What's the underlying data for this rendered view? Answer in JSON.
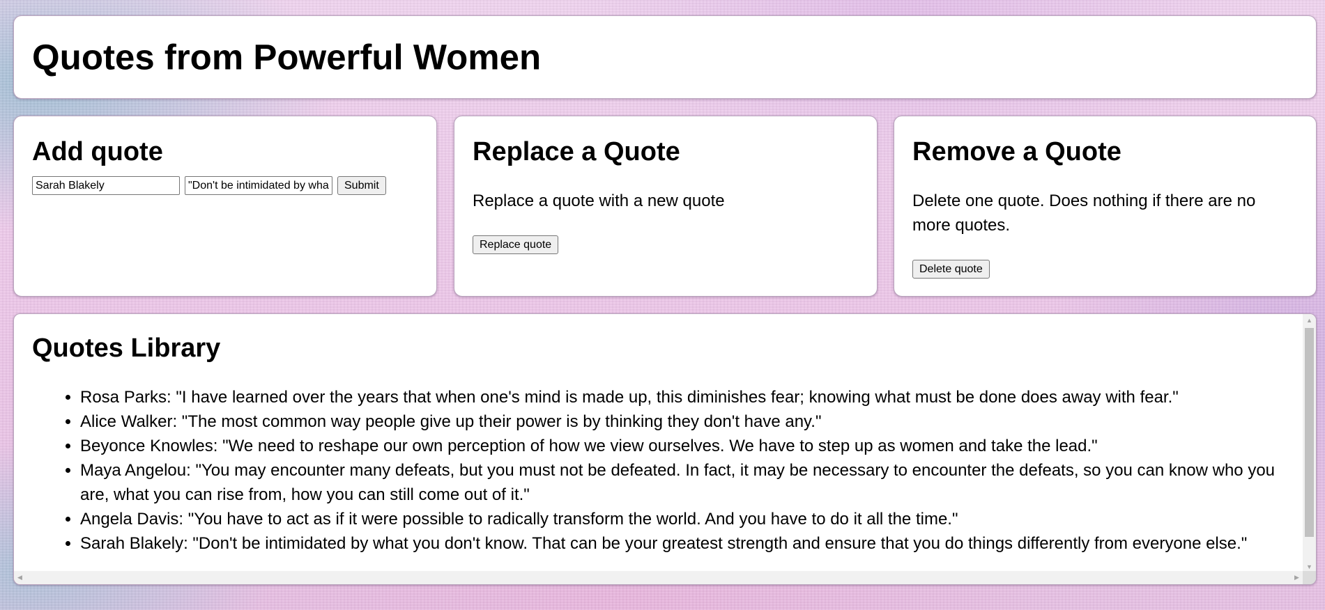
{
  "header": {
    "title": "Quotes from Powerful Women"
  },
  "add_quote": {
    "title": "Add quote",
    "author_value": "Sarah Blakely",
    "quote_value": "\"Don't be intimidated by what you don't know. That can be your greatest strength and ensure that you do things differently from everyone else.\"",
    "submit_label": "Submit"
  },
  "replace_quote": {
    "title": "Replace a Quote",
    "description": "Replace a quote with a new quote",
    "button_label": "Replace quote"
  },
  "remove_quote": {
    "title": "Remove a Quote",
    "description": "Delete one quote. Does nothing if there are no more quotes.",
    "button_label": "Delete quote"
  },
  "library": {
    "title": "Quotes Library",
    "quotes": [
      "Rosa Parks: \"I have learned over the years that when one's mind is made up, this diminishes fear; knowing what must be done does away with fear.\"",
      "Alice Walker: \"The most common way people give up their power is by thinking they don't have any.\"",
      "Beyonce Knowles: \"We need to reshape our own perception of how we view ourselves. We have to step up as women and take the lead.\"",
      "Maya Angelou: \"You may encounter many defeats, but you must not be defeated. In fact, it may be necessary to encounter the defeats, so you can know who you are, what you can rise from, how you can still come out of it.\"",
      "Angela Davis: \"You have to act as if it were possible to radically transform the world. And you have to do it all the time.\"",
      "Sarah Blakely: \"Don't be intimidated by what you don't know. That can be your greatest strength and ensure that you do things differently from everyone else.\""
    ]
  },
  "scrollbar_icons": {
    "up": "arrow-up-icon",
    "down": "arrow-down-icon",
    "left": "arrow-left-icon",
    "right": "arrow-right-icon"
  }
}
